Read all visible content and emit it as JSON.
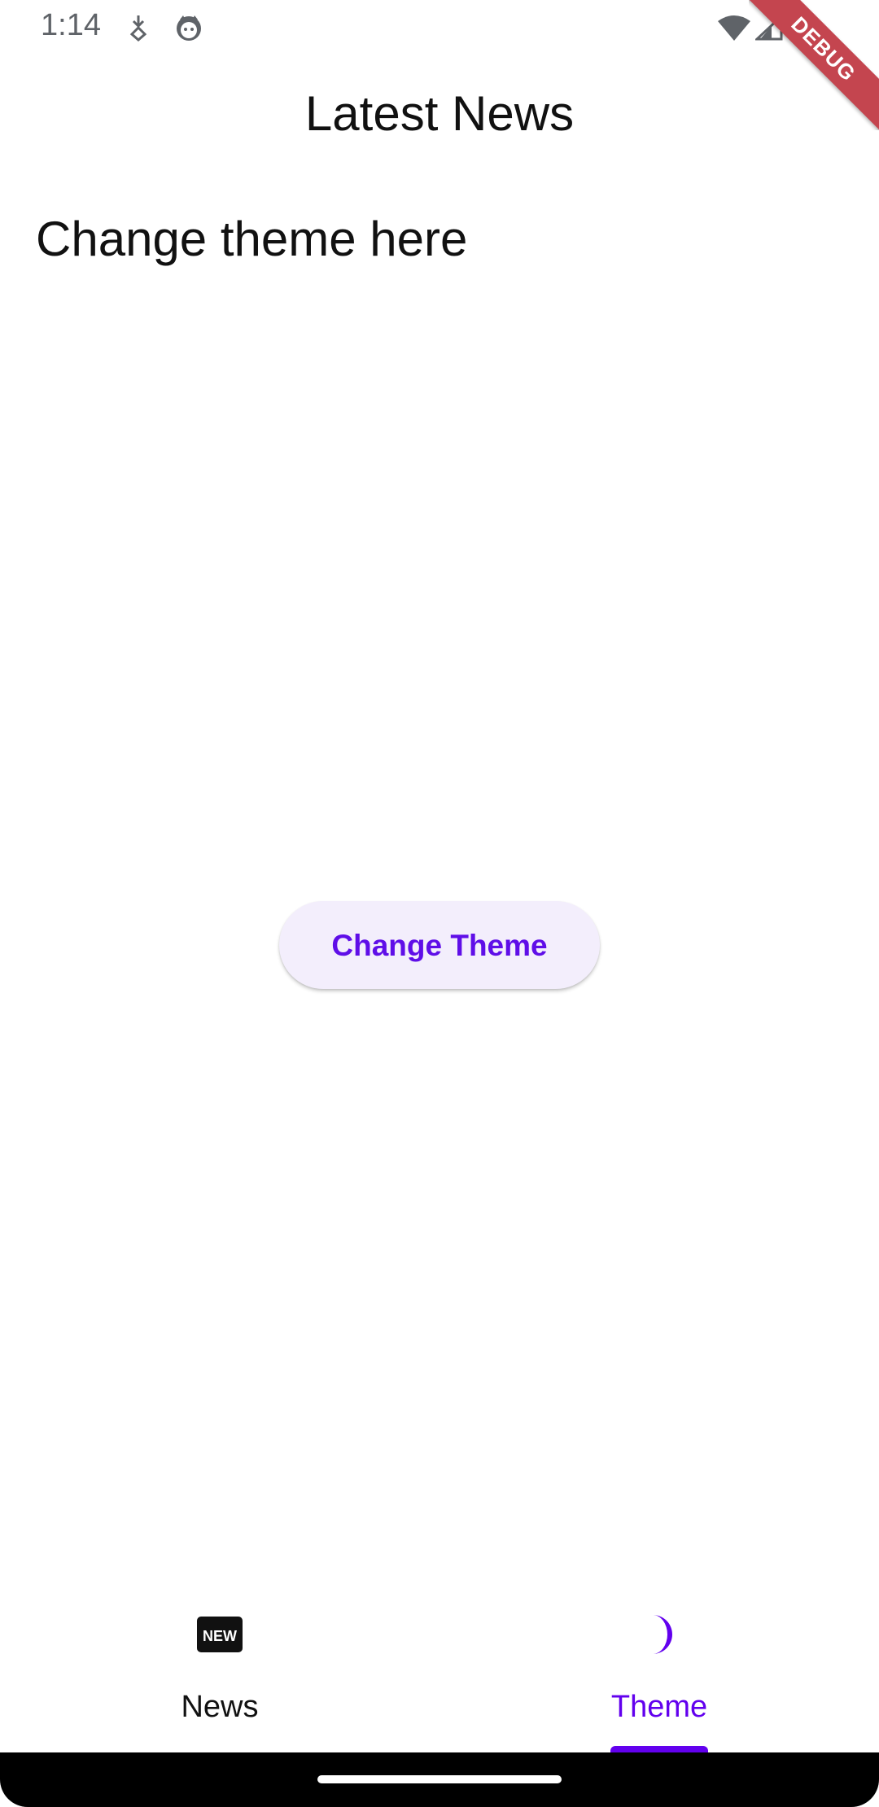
{
  "status_bar": {
    "time": "1:14",
    "icons": [
      "download-arrow-icon",
      "cat-face-icon",
      "wifi-icon",
      "cell-signal-icon"
    ]
  },
  "debug_banner": {
    "label": "DEBUG",
    "color": "#c4454f"
  },
  "app_bar": {
    "title": "Latest News"
  },
  "body": {
    "heading": "Change theme here",
    "button_label": "Change Theme"
  },
  "bottom_nav": {
    "selected": "theme",
    "items": [
      {
        "id": "news",
        "label": "News",
        "icon": "new-badge-icon",
        "icon_text": "NEW"
      },
      {
        "id": "theme",
        "label": "Theme",
        "icon": "moon-icon"
      }
    ]
  },
  "colors": {
    "accent": "#6200ee",
    "button_bg": "#f3eefc",
    "text_primary": "#111111",
    "status_text": "#5f6368"
  }
}
